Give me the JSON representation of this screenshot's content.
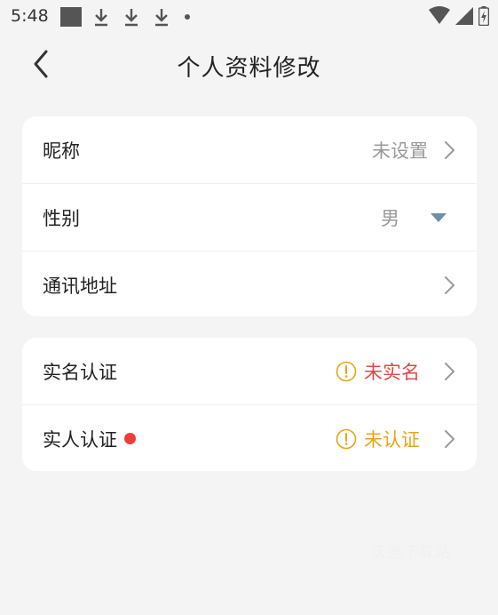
{
  "status_bar": {
    "time": "5:48"
  },
  "header": {
    "title": "个人资料修改"
  },
  "profile_section": {
    "nickname": {
      "label": "昵称",
      "value": "未设置"
    },
    "gender": {
      "label": "性别",
      "value": "男"
    },
    "address": {
      "label": "通讯地址"
    }
  },
  "verification_section": {
    "real_name": {
      "label": "实名认证",
      "status": "未实名",
      "status_color": "#e04646"
    },
    "real_person": {
      "label": "实人认证",
      "status": "未认证",
      "status_color": "#e6a417",
      "dot_color": "#ec3c3c"
    }
  },
  "watermark": "沃德下载站",
  "icons": {
    "back": "chevron-left-icon",
    "chevron": "chevron-right-icon",
    "dropdown": "caret-down-icon",
    "warning": "exclamation-circle-icon"
  }
}
